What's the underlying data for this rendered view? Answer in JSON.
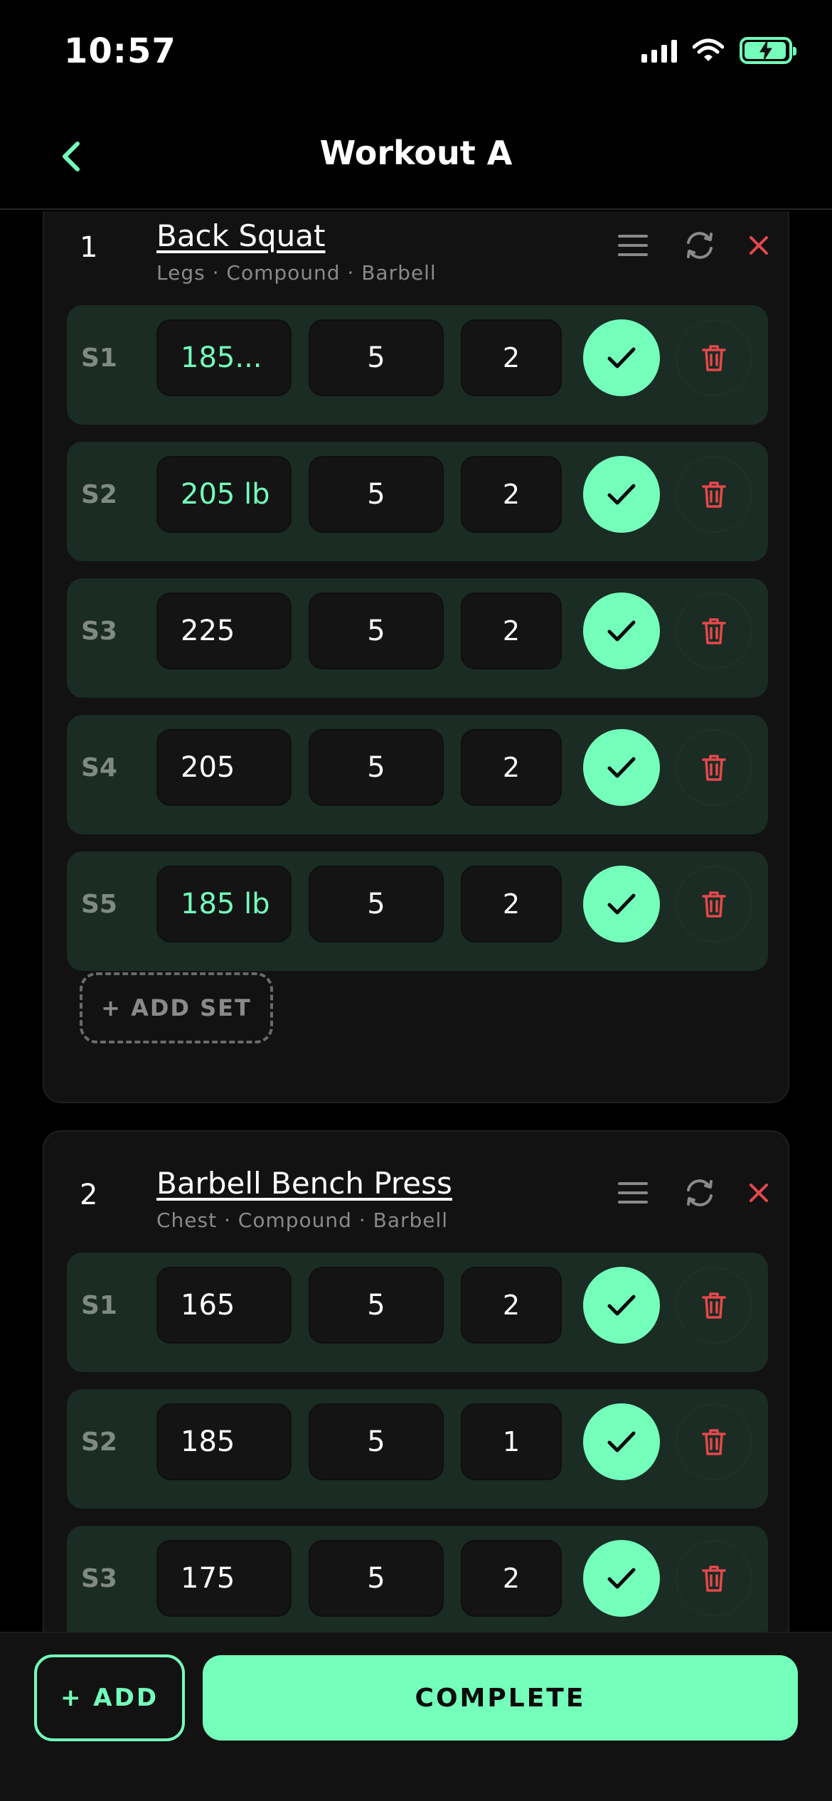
{
  "status_bar": {
    "time": "10:57"
  },
  "header": {
    "title": "Workout A",
    "back_icon": "chevron-left-icon"
  },
  "exercises": [
    {
      "number": "1",
      "name": "Back Squat",
      "meta": "Legs · Compound · Barbell",
      "sets": [
        {
          "label": "S1",
          "weight": "185...",
          "reps": "5",
          "rir": "2",
          "weight_highlight": true
        },
        {
          "label": "S2",
          "weight": "205 lb",
          "reps": "5",
          "rir": "2",
          "weight_highlight": true
        },
        {
          "label": "S3",
          "weight": "225",
          "reps": "5",
          "rir": "2",
          "weight_highlight": false
        },
        {
          "label": "S4",
          "weight": "205",
          "reps": "5",
          "rir": "2",
          "weight_highlight": false
        },
        {
          "label": "S5",
          "weight": "185 lb",
          "reps": "5",
          "rir": "2",
          "weight_highlight": true
        }
      ],
      "add_set_label": "+ ADD SET"
    },
    {
      "number": "2",
      "name": "Barbell Bench Press",
      "meta": "Chest · Compound · Barbell",
      "sets": [
        {
          "label": "S1",
          "weight": "165",
          "reps": "5",
          "rir": "2",
          "weight_highlight": false
        },
        {
          "label": "S2",
          "weight": "185",
          "reps": "5",
          "rir": "1",
          "weight_highlight": false
        },
        {
          "label": "S3",
          "weight": "175",
          "reps": "5",
          "rir": "2",
          "weight_highlight": false
        }
      ]
    }
  ],
  "bottom_bar": {
    "add_label": "+ ADD",
    "complete_label": "COMPLETE"
  },
  "colors": {
    "accent": "#74ffbb",
    "danger": "#e5484d",
    "set_row_bg": "#1a2c23",
    "card_bg": "#121212"
  }
}
